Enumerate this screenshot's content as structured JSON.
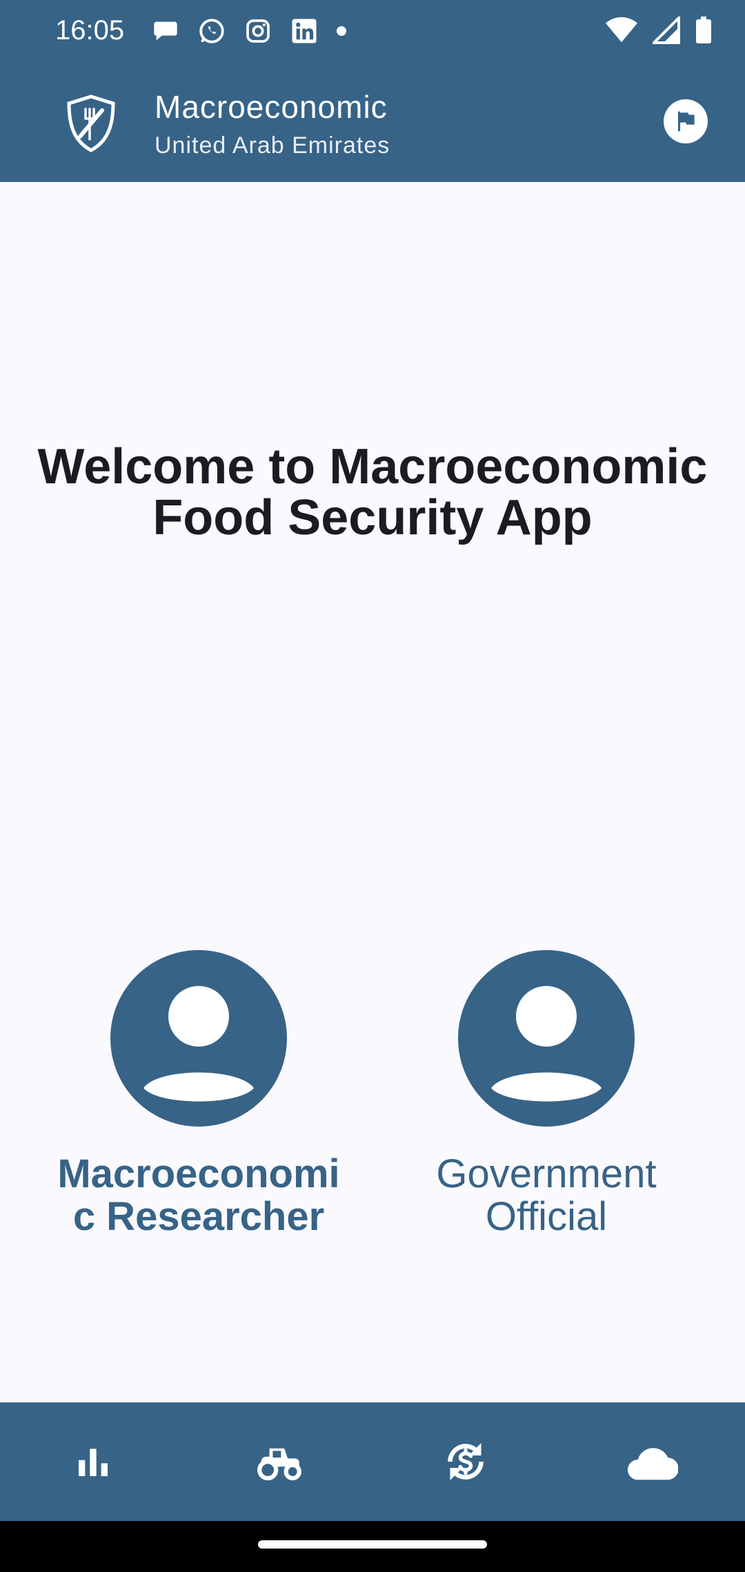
{
  "status_bar": {
    "time": "16:05",
    "notification_icons": [
      "chat-bubble-icon",
      "whatsapp-icon",
      "instagram-icon",
      "linkedin-icon",
      "dot-icon"
    ],
    "system_icons": [
      "wifi-icon",
      "signal-icon",
      "battery-icon"
    ]
  },
  "app_bar": {
    "title": "Macroeconomic",
    "subtitle": "United Arab Emirates",
    "logo_icon": "shield-fork-knife-icon",
    "action_icon": "flag-icon"
  },
  "main": {
    "welcome_text": "Welcome to Macroeconomic Food Security App",
    "roles": [
      {
        "label": "Macroeconomic Researcher",
        "icon": "account-circle-icon",
        "selected": true
      },
      {
        "label": "Government Official",
        "icon": "account-circle-icon",
        "selected": false
      }
    ]
  },
  "bottom_nav": {
    "items": [
      {
        "icon": "bar-chart-icon"
      },
      {
        "icon": "tractor-icon"
      },
      {
        "icon": "currency-exchange-icon"
      },
      {
        "icon": "cloud-icon"
      }
    ]
  },
  "colors": {
    "primary": "#376387",
    "background": "#faf9fd",
    "text": "#1d1b20"
  }
}
